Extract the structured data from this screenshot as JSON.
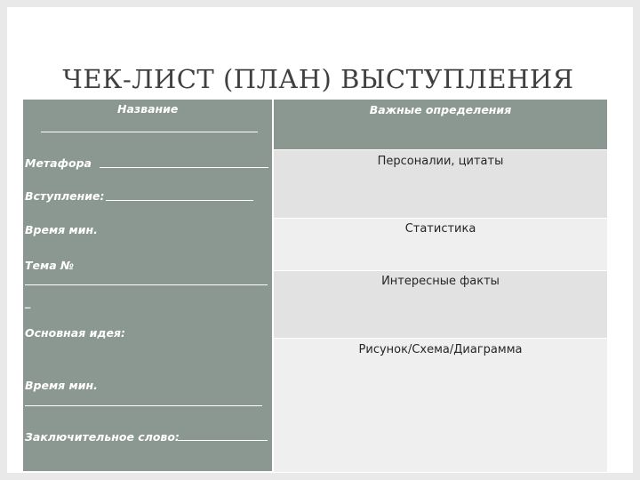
{
  "title": "ЧЕК-ЛИСТ (ПЛАН) ВЫСТУПЛЕНИЯ",
  "left": {
    "name": "Название",
    "metaphor": "Метафора",
    "intro": "Вступление:",
    "time1": "Время мин.",
    "topic": "Тема №",
    "dash": "_",
    "main_idea": "Основная идея:",
    "time2": "Время мин.",
    "closing": "Заключительное слово:"
  },
  "right": {
    "header": "Важные определения",
    "row1": "Персоналии, цитаты",
    "row2": "Статистика",
    "row3": "Интересные факты",
    "row4": "Рисунок/Схема/Диаграмма"
  }
}
